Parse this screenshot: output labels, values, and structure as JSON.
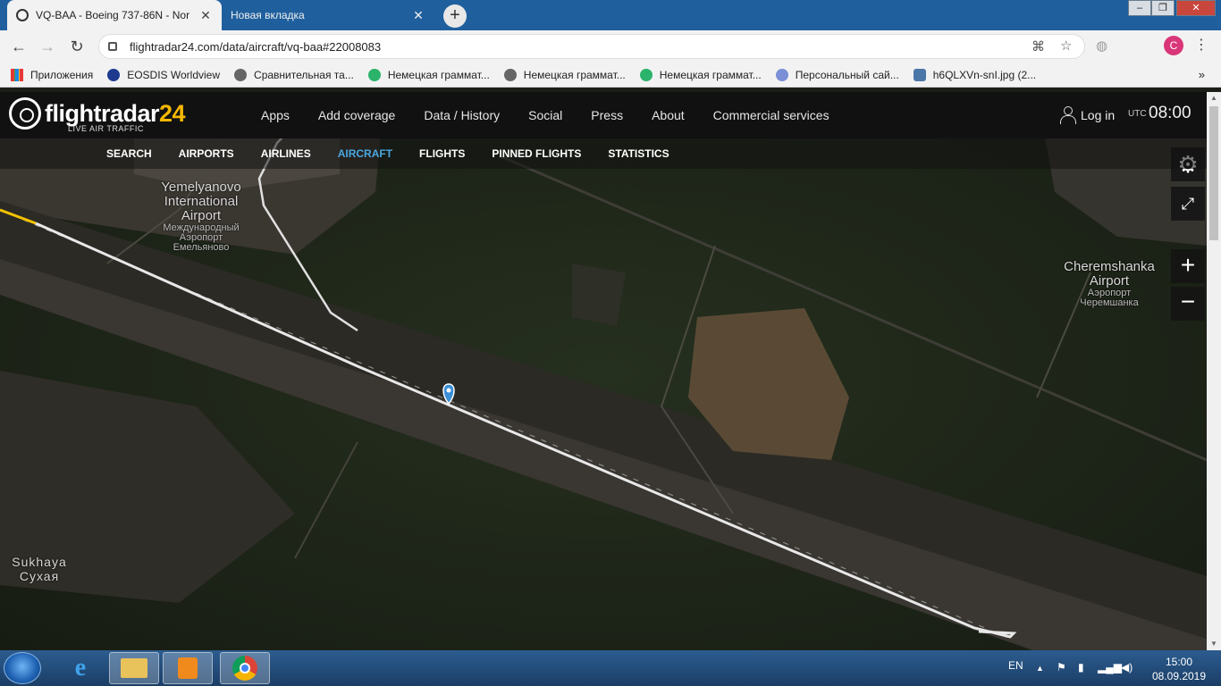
{
  "browser": {
    "tabs": [
      {
        "title": "VQ-BAA - Boeing 737-86N - Nor",
        "active": true
      },
      {
        "title": "Новая вкладка",
        "active": false
      }
    ],
    "url": "flightradar24.com/data/aircraft/vq-baa#22008083",
    "avatar_letter": "C",
    "bookmarks": [
      {
        "label": "Приложения",
        "icon": "apps-grid-icon"
      },
      {
        "label": "EOSDIS Worldview",
        "icon": "nasa-icon"
      },
      {
        "label": "Сравнительная та...",
        "icon": "globe-icon"
      },
      {
        "label": "Немецкая граммат...",
        "icon": "green-logo-icon"
      },
      {
        "label": "Немецкая граммат...",
        "icon": "globe-icon"
      },
      {
        "label": "Немецкая граммат...",
        "icon": "green-logo-icon"
      },
      {
        "label": "Персональный сай...",
        "icon": "shield-icon"
      },
      {
        "label": "h6QLXVn-snI.jpg (2...",
        "icon": "vk-icon"
      }
    ],
    "bookmarks_more": "»"
  },
  "fr": {
    "logo_name": "flightradar",
    "logo_num": "24",
    "logo_sub": "LIVE AIR TRAFFIC",
    "nav": [
      "Apps",
      "Add coverage",
      "Data / History",
      "Social",
      "Press",
      "About",
      "Commercial services"
    ],
    "login": "Log in",
    "utc_label": "UTC",
    "time": "08:00",
    "subnav": [
      "SEARCH",
      "AIRPORTS",
      "AIRLINES",
      "AIRCRAFT",
      "FLIGHTS",
      "PINNED FLIGHTS",
      "STATISTICS"
    ],
    "subnav_current": "AIRCRAFT"
  },
  "map": {
    "labels": {
      "yemelyanovo": [
        "Yemelyanovo",
        "International",
        "Airport"
      ],
      "yemelyanovo_ru": [
        "Международный",
        "Аэропорт",
        "Емельяново"
      ],
      "cheremshanka": [
        "Cheremshanka",
        "Airport"
      ],
      "cheremshanka_ru": [
        "Аэропорт",
        "Черемшанка"
      ],
      "sukhaya": "Sukhaya",
      "sukhaya_ru": "Сухая"
    },
    "controls": {
      "zoom_in": "+",
      "zoom_out": "−"
    },
    "colors": {
      "track": "#e8e8e8",
      "aircraft": "#f5c400",
      "pin": "#3a8fd6"
    }
  },
  "taskbar": {
    "lang": "EN",
    "time": "15:00",
    "date": "08.09.2019"
  }
}
